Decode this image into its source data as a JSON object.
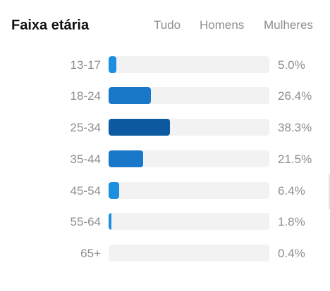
{
  "header": {
    "title": "Faixa etária",
    "tabs": [
      {
        "label": "Tudo",
        "active": true
      },
      {
        "label": "Homens",
        "active": false
      },
      {
        "label": "Mulheres",
        "active": false
      }
    ]
  },
  "colors": {
    "accent": "#1f8ad1",
    "bar_light": "#1d8fe1",
    "bar_mid": "#1877c8",
    "bar_dark": "#0d5aa0",
    "track": "#f2f2f2",
    "muted_text": "#8e8e8e"
  },
  "age_groups": [
    {
      "range": "13-17",
      "percent_label": "5.0%",
      "value": 5.0
    },
    {
      "range": "18-24",
      "percent_label": "26.4%",
      "value": 26.4
    },
    {
      "range": "25-34",
      "percent_label": "38.3%",
      "value": 38.3
    },
    {
      "range": "35-44",
      "percent_label": "21.5%",
      "value": 21.5
    },
    {
      "range": "45-54",
      "percent_label": "6.4%",
      "value": 6.4
    },
    {
      "range": "55-64",
      "percent_label": "1.8%",
      "value": 1.8
    },
    {
      "range": "65+",
      "percent_label": "0.4%",
      "value": 0.4
    }
  ]
}
